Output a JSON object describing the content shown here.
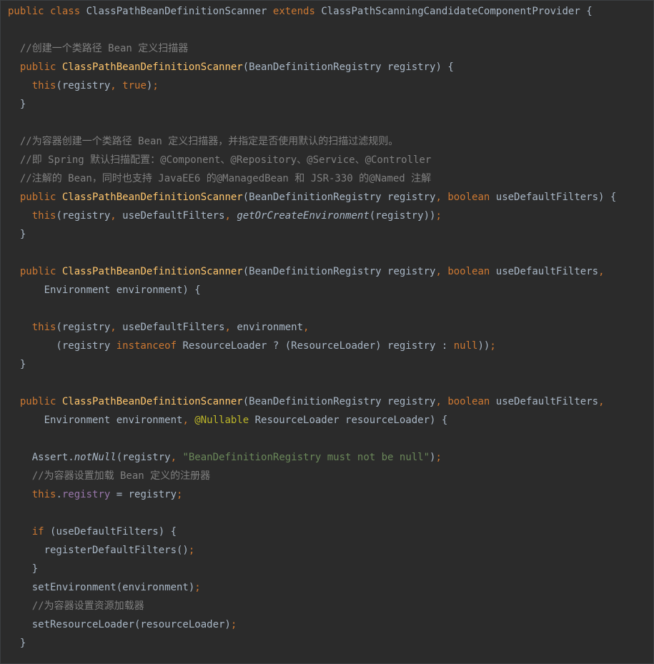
{
  "editor": {
    "lines": [
      [
        {
          "t": "public ",
          "c": "kw"
        },
        {
          "t": "class ",
          "c": "kw"
        },
        {
          "t": "ClassPathBeanDefinitionScanner "
        },
        {
          "t": "extends ",
          "c": "kw"
        },
        {
          "t": "ClassPathScanningCandidateComponentProvider {"
        }
      ],
      [],
      [
        {
          "t": "  "
        },
        {
          "t": "//创建一个类路径 Bean 定义扫描器",
          "c": "cm"
        }
      ],
      [
        {
          "t": "  "
        },
        {
          "t": "public ",
          "c": "kw"
        },
        {
          "t": "ClassPathBeanDefinitionScanner",
          "c": "fn"
        },
        {
          "t": "(BeanDefinitionRegistry registry) {"
        }
      ],
      [
        {
          "t": "    "
        },
        {
          "t": "this",
          "c": "kw"
        },
        {
          "t": "(registry"
        },
        {
          "t": ", ",
          "c": "kw"
        },
        {
          "t": "true",
          "c": "kw"
        },
        {
          "t": ")"
        },
        {
          "t": ";",
          "c": "kw"
        }
      ],
      [
        {
          "t": "  }"
        }
      ],
      [],
      [
        {
          "t": "  "
        },
        {
          "t": "//为容器创建一个类路径 Bean 定义扫描器，并指定是否使用默认的扫描过滤规则。",
          "c": "cm"
        }
      ],
      [
        {
          "t": "  "
        },
        {
          "t": "//即 Spring 默认扫描配置：@Component、@Repository、@Service、@Controller",
          "c": "cm"
        }
      ],
      [
        {
          "t": "  "
        },
        {
          "t": "//注解的 Bean，同时也支持 JavaEE6 的@ManagedBean 和 JSR-330 的@Named 注解",
          "c": "cm"
        }
      ],
      [
        {
          "t": "  "
        },
        {
          "t": "public ",
          "c": "kw"
        },
        {
          "t": "ClassPathBeanDefinitionScanner",
          "c": "fn"
        },
        {
          "t": "(BeanDefinitionRegistry registry"
        },
        {
          "t": ", ",
          "c": "kw"
        },
        {
          "t": "boolean ",
          "c": "kw"
        },
        {
          "t": "useDefaultFilters) {"
        }
      ],
      [
        {
          "t": "    "
        },
        {
          "t": "this",
          "c": "kw"
        },
        {
          "t": "(registry"
        },
        {
          "t": ", ",
          "c": "kw"
        },
        {
          "t": "useDefaultFilters"
        },
        {
          "t": ", ",
          "c": "kw"
        },
        {
          "t": "getOrCreateEnvironment",
          "c": "it"
        },
        {
          "t": "(registry))"
        },
        {
          "t": ";",
          "c": "kw"
        }
      ],
      [
        {
          "t": "  }"
        }
      ],
      [],
      [
        {
          "t": "  "
        },
        {
          "t": "public ",
          "c": "kw"
        },
        {
          "t": "ClassPathBeanDefinitionScanner",
          "c": "fn"
        },
        {
          "t": "(BeanDefinitionRegistry registry"
        },
        {
          "t": ", ",
          "c": "kw"
        },
        {
          "t": "boolean ",
          "c": "kw"
        },
        {
          "t": "useDefaultFilters"
        },
        {
          "t": ",",
          "c": "kw"
        }
      ],
      [
        {
          "t": "      Environment environment) {"
        }
      ],
      [],
      [
        {
          "t": "    "
        },
        {
          "t": "this",
          "c": "kw"
        },
        {
          "t": "(registry"
        },
        {
          "t": ", ",
          "c": "kw"
        },
        {
          "t": "useDefaultFilters"
        },
        {
          "t": ", ",
          "c": "kw"
        },
        {
          "t": "environment"
        },
        {
          "t": ",",
          "c": "kw"
        }
      ],
      [
        {
          "t": "        (registry "
        },
        {
          "t": "instanceof ",
          "c": "kw"
        },
        {
          "t": "ResourceLoader ? (ResourceLoader) registry : "
        },
        {
          "t": "null",
          "c": "kw"
        },
        {
          "t": "))"
        },
        {
          "t": ";",
          "c": "kw"
        }
      ],
      [
        {
          "t": "  }"
        }
      ],
      [],
      [
        {
          "t": "  "
        },
        {
          "t": "public ",
          "c": "kw"
        },
        {
          "t": "ClassPathBeanDefinitionScanner",
          "c": "fn"
        },
        {
          "t": "(BeanDefinitionRegistry registry"
        },
        {
          "t": ", ",
          "c": "kw"
        },
        {
          "t": "boolean ",
          "c": "kw"
        },
        {
          "t": "useDefaultFilters"
        },
        {
          "t": ",",
          "c": "kw"
        }
      ],
      [
        {
          "t": "      Environment environment"
        },
        {
          "t": ", ",
          "c": "kw"
        },
        {
          "t": "@Nullable ",
          "c": "ann"
        },
        {
          "t": "ResourceLoader resourceLoader) {"
        }
      ],
      [],
      [
        {
          "t": "    Assert."
        },
        {
          "t": "notNull",
          "c": "it"
        },
        {
          "t": "(registry"
        },
        {
          "t": ", ",
          "c": "kw"
        },
        {
          "t": "\"BeanDefinitionRegistry must not be null\"",
          "c": "str"
        },
        {
          "t": ")"
        },
        {
          "t": ";",
          "c": "kw"
        }
      ],
      [
        {
          "t": "    "
        },
        {
          "t": "//为容器设置加载 Bean 定义的注册器",
          "c": "cm"
        }
      ],
      [
        {
          "t": "    "
        },
        {
          "t": "this",
          "c": "kw"
        },
        {
          "t": "."
        },
        {
          "t": "registry",
          "c": "fld"
        },
        {
          "t": " = registry"
        },
        {
          "t": ";",
          "c": "kw"
        }
      ],
      [],
      [
        {
          "t": "    "
        },
        {
          "t": "if ",
          "c": "kw"
        },
        {
          "t": "(useDefaultFilters) {"
        }
      ],
      [
        {
          "t": "      registerDefaultFilters()"
        },
        {
          "t": ";",
          "c": "kw"
        }
      ],
      [
        {
          "t": "    }"
        }
      ],
      [
        {
          "t": "    setEnvironment(environment)"
        },
        {
          "t": ";",
          "c": "kw"
        }
      ],
      [
        {
          "t": "    "
        },
        {
          "t": "//为容器设置资源加载器",
          "c": "cm"
        }
      ],
      [
        {
          "t": "    setResourceLoader(resourceLoader)"
        },
        {
          "t": ";",
          "c": "kw"
        }
      ],
      [
        {
          "t": "  }"
        }
      ]
    ]
  },
  "colors": {
    "background": "#2b2b2b",
    "text": "#a9b7c6",
    "keyword": "#cc7832",
    "method": "#ffc66d",
    "comment": "#808080",
    "string": "#6a8759",
    "annotation": "#bbb529",
    "field": "#9876aa"
  }
}
